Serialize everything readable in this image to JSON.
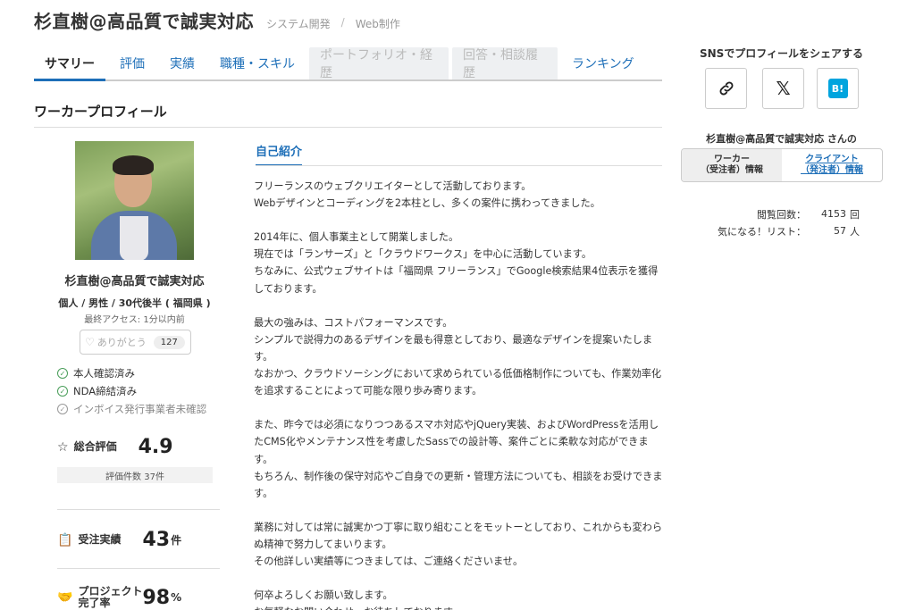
{
  "header": {
    "title": "杉直樹@高品質で誠実対応",
    "breadcrumb": [
      "システム開発",
      "/",
      "Web制作"
    ]
  },
  "tabs": [
    {
      "label": "サマリー",
      "state": "active"
    },
    {
      "label": "評価",
      "state": "normal"
    },
    {
      "label": "実績",
      "state": "normal"
    },
    {
      "label": "職種・スキル",
      "state": "normal"
    },
    {
      "label": "ポートフォリオ・経歴",
      "state": "disabled"
    },
    {
      "label": "回答・相談履歴",
      "state": "disabled"
    },
    {
      "label": "ランキング",
      "state": "normal"
    }
  ],
  "section_title": "ワーカープロフィール",
  "profile": {
    "name": "杉直樹@高品質で誠実対応",
    "meta": "個人 / 男性 / 30代後半 ( 福岡県 )",
    "last_access": "最終アクセス: 1分以内前",
    "thanks_label": "ありがとう",
    "thanks_count": "127",
    "checks": [
      {
        "label": "本人確認済み",
        "status": "ok"
      },
      {
        "label": "NDA締結済み",
        "status": "ok"
      },
      {
        "label": "インボイス発行事業者未確認",
        "status": "pending"
      }
    ]
  },
  "stats": {
    "rating_label": "総合評価",
    "rating_value": "4.9",
    "rating_count": "評価件数 37件",
    "orders_label": "受注実績",
    "orders_value": "43",
    "orders_unit": "件",
    "completion_label": "プロジェクト完了率",
    "completion_value": "98",
    "completion_unit": "%"
  },
  "intro": {
    "tab_label": "自己紹介",
    "text": "フリーランスのウェブクリエイターとして活動しております。\nWebデザインとコーディングを2本柱とし、多くの案件に携わってきました。\n\n2014年に、個人事業主として開業しました。\n現在では「ランサーズ」と「クラウドワークス」を中心に活動しています。\nちなみに、公式ウェブサイトは「福岡県 フリーランス」でGoogle検索結果4位表示を獲得しております。\n\n最大の強みは、コストパフォーマンスです。\nシンプルで説得力のあるデザインを最も得意としており、最適なデザインを提案いたします。\nなおかつ、クラウドソーシングにおいて求められている低価格制作についても、作業効率化を追求することによって可能な限り歩み寄ります。\n\nまた、昨今では必須になりつつあるスマホ対応やjQuery実装、およびWordPressを活用したCMS化やメンテナンス性を考慮したSassでの設計等、案件ごとに柔軟な対応ができます。\nもちろん、制作後の保守対応やご自身での更新・管理方法についても、相談をお受けできます。\n\n業務に対しては常に誠実かつ丁寧に取り組むことをモットーとしており、これからも変わらぬ精神で努力してまいります。\nその他詳しい実績等につきましては、ご連絡くださいませ。\n\n何卒よろしくお願い致します。\nお気軽なお問い合わせ、お待ちしております。"
  },
  "sidebar": {
    "sns_title": "SNSでプロフィールをシェアする",
    "sns_buttons": [
      "link-icon",
      "x-icon",
      "hatena-bookmark-icon"
    ],
    "hatena_glyph": "B!",
    "x_glyph": "𝕏",
    "owner_label": "杉直樹@高品質で誠実対応 さんの",
    "role_worker": [
      "ワーカー",
      "（受注者）情報"
    ],
    "role_client": [
      "クライアント",
      "（発注者）情報"
    ],
    "views_label": "閲覧回数：",
    "views_value": "4153",
    "views_unit": "回",
    "fav_label": "気になる！リスト：",
    "fav_value": "57",
    "fav_unit": "人"
  },
  "colors": {
    "accent": "#1e6fb8",
    "check_ok": "#4a9e5a",
    "hatena": "#00a4de"
  }
}
